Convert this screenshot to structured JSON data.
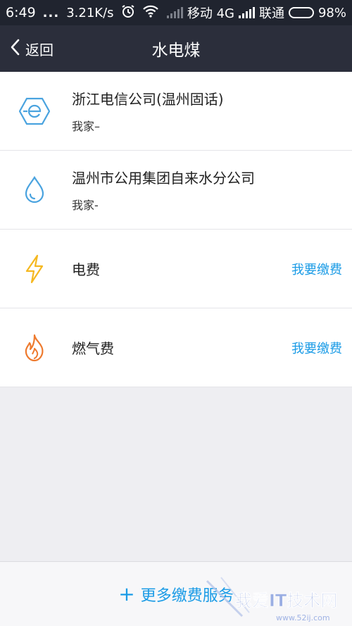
{
  "status_bar": {
    "time": "6:49",
    "dots": "...",
    "speed": "3.21K/s",
    "carrier1": "移动 4G",
    "carrier2": "联通",
    "battery": "98%"
  },
  "nav": {
    "back_label": "返回",
    "title": "水电煤"
  },
  "list": [
    {
      "name": "浙江电信公司(温州固话)",
      "sub": "我家–",
      "icon": "telecom-e-icon",
      "color": "#4aa3df"
    },
    {
      "name": "温州市公用集团自来水分公司",
      "sub": "我家-",
      "icon": "water-drop-icon",
      "color": "#4aa3df"
    },
    {
      "name": "电费",
      "action": "我要缴费",
      "icon": "lightning-icon",
      "color": "#f5b820"
    },
    {
      "name": "燃气费",
      "action": "我要缴费",
      "icon": "flame-icon",
      "color": "#ee7a2e"
    }
  ],
  "footer": {
    "plus": "+",
    "label": "更多缴费服务"
  },
  "watermark": {
    "text": "我爱IT技术网",
    "url": "www.52ij.com"
  },
  "colors": {
    "accent": "#1a9be6",
    "navbar": "#2b2e3b",
    "statusbar": "#20242f"
  }
}
